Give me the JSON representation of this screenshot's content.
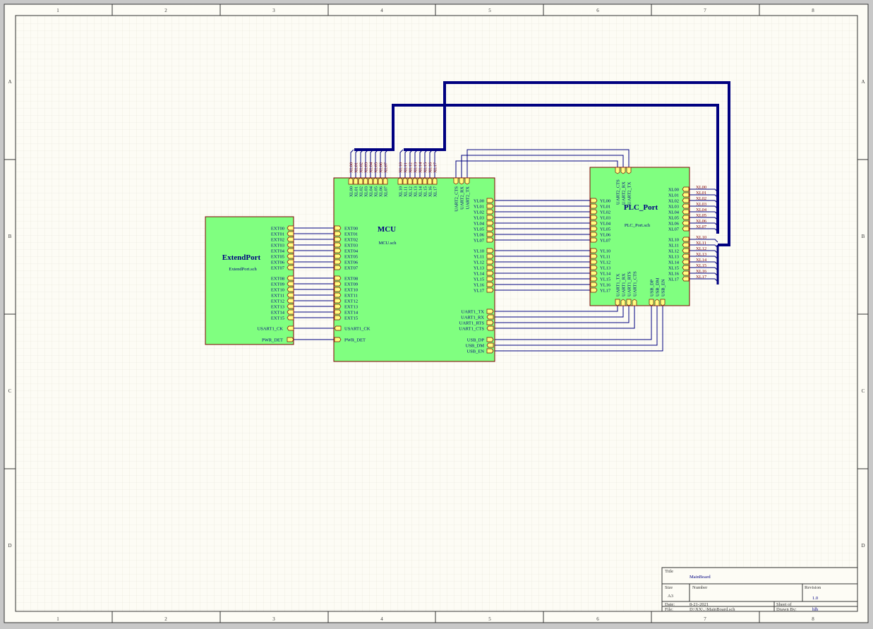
{
  "frame": {
    "columns": [
      "1",
      "2",
      "3",
      "4",
      "5",
      "6",
      "7",
      "8"
    ],
    "rows": [
      "A",
      "B",
      "C",
      "D"
    ]
  },
  "colors": {
    "background": "#fdfcf5",
    "grid": "#e3e1d4",
    "sheet_fill": "#80ff80",
    "sheet_border": "#800000",
    "bus": "#000080",
    "wire": "#000080",
    "port_fill": "#ffff80",
    "net_label": "#800000",
    "text_blue": "#000080"
  },
  "sheets": {
    "extend": {
      "name": "ExtendPort",
      "file": "ExtendPort.sch",
      "ports_a": [
        "EXT00",
        "EXT01",
        "EXT02",
        "EXT03",
        "EXT04",
        "EXT05",
        "EXT06",
        "EXT07"
      ],
      "ports_b": [
        "EXT08",
        "EXT09",
        "EXT10",
        "EXT11",
        "EXT12",
        "EXT13",
        "EXT14",
        "EXT15"
      ],
      "usart_ck": "USART1_CK",
      "pwr_det": "PWR_DET"
    },
    "mcu": {
      "name": "MCU",
      "file": "MCU.sch",
      "ext_a": [
        "EXT00",
        "EXT01",
        "EXT02",
        "EXT03",
        "EXT04",
        "EXT05",
        "EXT06",
        "EXT07"
      ],
      "ext_b": [
        "EXT08",
        "EXT09",
        "EXT10",
        "EXT11",
        "EXT12",
        "EXT13",
        "EXT14",
        "EXT15"
      ],
      "usart_ck": "USART1_CK",
      "pwr_det": "PWR_DET",
      "top_xl0": [
        "XL00",
        "XL01",
        "XL02",
        "XL03",
        "XL04",
        "XL05",
        "XL06",
        "XL07"
      ],
      "top_xl1": [
        "XL10",
        "XL11",
        "XL12",
        "XL13",
        "XL14",
        "XL15",
        "XL16",
        "XL17"
      ],
      "top_uart2": [
        "UART2_CTS",
        "UART2_RX",
        "UART2_TX"
      ],
      "yl0": [
        "YL00",
        "YL01",
        "YL02",
        "YL03",
        "YL04",
        "YL05",
        "YL06",
        "YL07"
      ],
      "yl1": [
        "YL10",
        "YL11",
        "YL12",
        "YL13",
        "YL14",
        "YL15",
        "YL16",
        "YL17"
      ],
      "uart1": [
        "UART1_TX",
        "UART1_RX",
        "UART1_RTS",
        "UART1_CTS"
      ],
      "usb": [
        "USB_DP",
        "USB_DM",
        "USB_EN"
      ]
    },
    "plc": {
      "name": "PLC_Port",
      "file": "PLC_Port.sch",
      "top_uart2": [
        "UART2_CTS",
        "UART2_RX",
        "UART2_TX"
      ],
      "yl0": [
        "YL00",
        "YL01",
        "YL02",
        "YL03",
        "YL04",
        "YL05",
        "YL06",
        "YL07"
      ],
      "yl1": [
        "YL10",
        "YL11",
        "YL12",
        "YL13",
        "YL14",
        "YL15",
        "YL16",
        "YL17"
      ],
      "xl0": [
        "XL00",
        "XL01",
        "XL02",
        "XL03",
        "XL04",
        "XL05",
        "XL06",
        "XL07"
      ],
      "xl1": [
        "XL10",
        "XL11",
        "XL12",
        "XL13",
        "XL14",
        "XL15",
        "XL16",
        "XL17"
      ],
      "bottom_uart1": [
        "UART1_TX",
        "UART1_RX",
        "UART1_RTS",
        "UART1_CTS"
      ],
      "bottom_usb": [
        "USB_DP",
        "USB_DM",
        "USB_EN"
      ]
    }
  },
  "net_labels": {
    "mcu_top_xl0": [
      "XL00",
      "XL01",
      "XL02",
      "XL03",
      "XL04",
      "XL05",
      "XL06",
      "XL07"
    ],
    "mcu_top_xl1": [
      "XL10",
      "XL11",
      "XL12",
      "XL13",
      "XL14",
      "XL15",
      "XL16",
      "XL17"
    ],
    "plc_right_xl0": [
      "XL00",
      "XL01",
      "XL02",
      "XL03",
      "XL04",
      "XL05",
      "XL06",
      "XL07"
    ],
    "plc_right_xl1": [
      "XL10",
      "XL11",
      "XL12",
      "XL13",
      "XL14",
      "XL15",
      "XL16",
      "XL17"
    ]
  },
  "title_block": {
    "title_label": "Title",
    "title_value": "MainBoard",
    "size_label": "Size",
    "size_value": "A3",
    "number_label": "Number",
    "revision_label": "Revision",
    "revision_value": "1.0",
    "date_label": "Date:",
    "date_value": "8-21-2021",
    "sheet_label": "Sheet   of",
    "file_label": "File:",
    "file_value": "D:\\XX\\..\\MainBoard.sch",
    "drawn_label": "Drawn By:",
    "drawn_value": "hlh"
  }
}
